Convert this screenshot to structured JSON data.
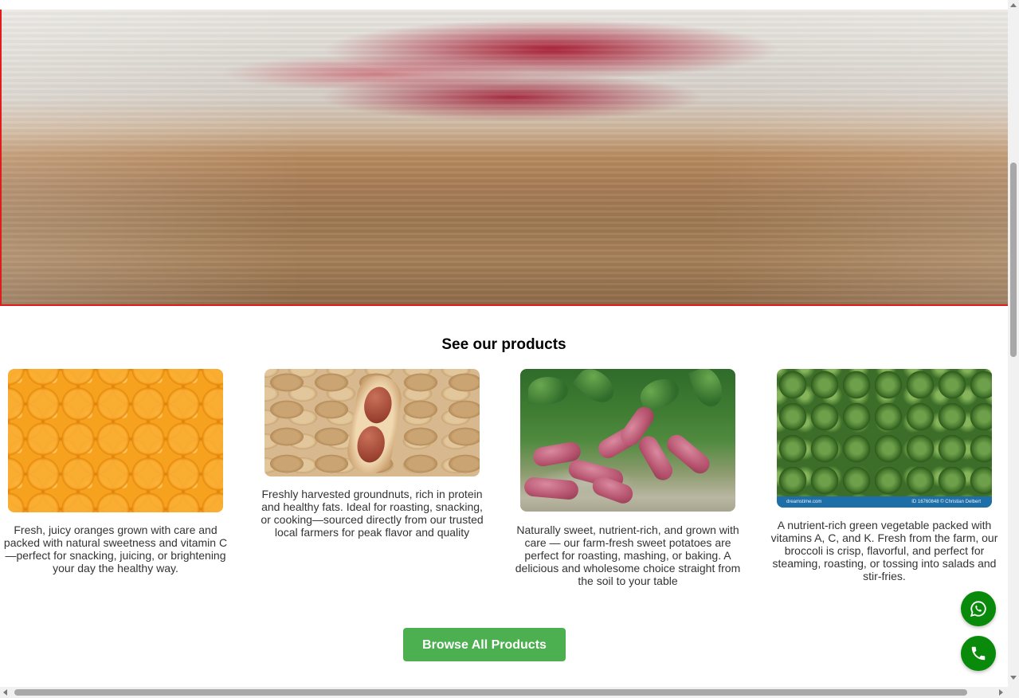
{
  "section": {
    "title": "See our products"
  },
  "products": [
    {
      "name": "oranges",
      "description": "Fresh, juicy oranges grown with care and packed with natural sweetness and vitamin C—perfect for snacking, juicing, or brightening your day the healthy way."
    },
    {
      "name": "groundnuts",
      "description": "Freshly harvested groundnuts, rich in protein and healthy fats. Ideal for roasting, snacking, or cooking—sourced directly from our trusted local farmers for peak flavor and quality"
    },
    {
      "name": "sweet-potatoes",
      "description": "Naturally sweet, nutrient-rich, and grown with care — our farm-fresh sweet potatoes are perfect for roasting, mashing, or baking. A delicious and wholesome choice straight from the soil to your table"
    },
    {
      "name": "broccoli",
      "description": "A nutrient-rich green vegetable packed with vitamins A, C, and K. Fresh from the farm, our broccoli is crisp, flavorful, and perfect for steaming, roasting, or tossing into salads and stir-fries.",
      "watermark_left": "dreamstime.com",
      "watermark_right": "ID 16760848 © Christian Delbert"
    }
  ],
  "actions": {
    "browse_label": "Browse All Products"
  },
  "floating": {
    "whatsapp_icon": "whatsapp-icon",
    "phone_icon": "phone-icon",
    "color": "#0a8a0a"
  },
  "colors": {
    "button": "#4caf50",
    "hero_border": "#e01b1b"
  }
}
